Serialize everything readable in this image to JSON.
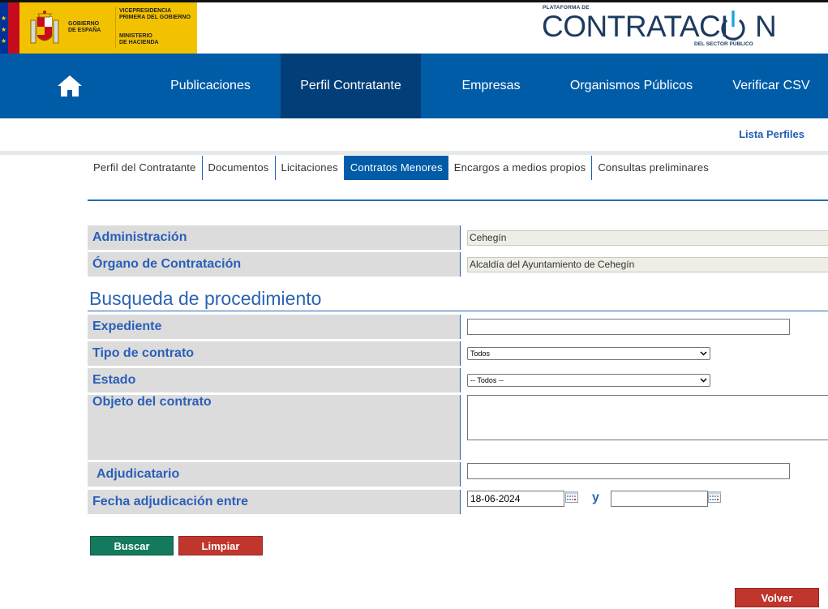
{
  "header": {
    "gov_line1": "GOBIERNO",
    "gov_line2": "DE ESPAÑA",
    "vice_line1": "VICEPRESIDENCIA",
    "vice_line2": "PRIMERA DEL GOBIERNO",
    "min_line1": "MINISTERIO",
    "min_line2": "DE HACIENDA",
    "brand_small": "PLATAFORMA DE",
    "brand_big": "CONTRATACI",
    "brand_big_end": "N",
    "brand_sub": "DEL SECTOR PÚBLICO"
  },
  "nav": {
    "home_icon": "home-icon",
    "items": [
      "Publicaciones",
      "Perfil Contratante",
      "Empresas",
      "Organismos Públicos",
      "Verificar CSV"
    ],
    "active": "Perfil Contratante"
  },
  "lista_perfiles": "Lista Perfiles",
  "tabs": {
    "items": [
      "Perfil del Contratante",
      "Documentos",
      "Licitaciones",
      "Contratos Menores",
      "Encargos a medios propios",
      "Consultas preliminares"
    ],
    "active": "Contratos Menores"
  },
  "info": {
    "administracion_label": "Administración",
    "administracion_value": "Cehegín",
    "organo_label": "Órgano de Contratación",
    "organo_value": "Alcaldía del Ayuntamiento de Cehegín"
  },
  "search": {
    "title": "Busqueda de procedimiento",
    "expediente_label": "Expediente",
    "expediente_value": "",
    "tipo_label": "Tipo de contrato",
    "tipo_value": "Todos",
    "estado_label": "Estado",
    "estado_value": "-- Todos --",
    "objeto_label": "Objeto del contrato",
    "objeto_value": "",
    "adjudicatario_label": "Adjudicatario",
    "adjudicatario_value": "",
    "fecha_label": "Fecha adjudicación entre",
    "fecha_desde": "18-06-2024",
    "fecha_y": "y",
    "fecha_hasta": ""
  },
  "buttons": {
    "buscar": "Buscar",
    "limpiar": "Limpiar",
    "volver": "Volver"
  },
  "colors": {
    "nav_bg": "#015ca8",
    "nav_active": "#023e78",
    "label_text": "#2b5fb8",
    "buscar": "#137a5e",
    "limpiar": "#c0362c"
  }
}
